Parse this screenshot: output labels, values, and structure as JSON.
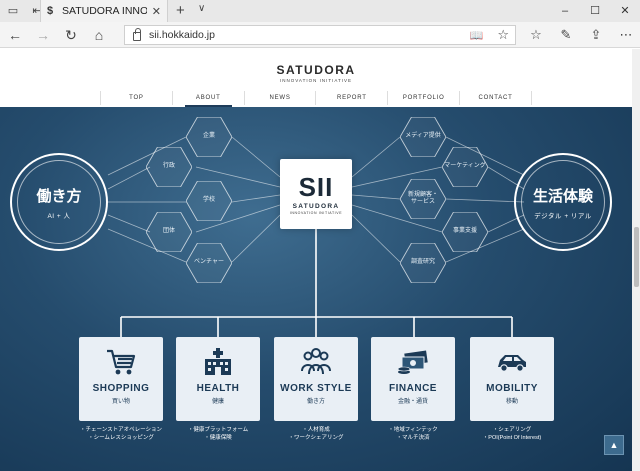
{
  "browser": {
    "tab_title": "SATUDORA INNOVATIO",
    "tab_icon": "dollar-s",
    "url": "sii.hokkaido.jp",
    "window_buttons": [
      "–",
      "☐",
      "✕"
    ]
  },
  "site": {
    "brand_name": "SATUDORA",
    "brand_sub": "INNOVATION INITIATIVE",
    "nav": [
      "TOP",
      "ABOUT",
      "NEWS",
      "REPORT",
      "PORTFOLIO",
      "CONTACT"
    ],
    "active_nav": "ABOUT"
  },
  "hero": {
    "left_circle": {
      "title": "働き方",
      "sub": "AI + 人"
    },
    "right_circle": {
      "title": "生活体験",
      "sub": "デジタル + リアル"
    },
    "left_hexes": [
      "企業",
      "行政",
      "学校",
      "団体",
      "ベンチャー"
    ],
    "right_hexes": [
      "メディア提供",
      "マーケティング",
      "新規顧客・\nサービス",
      "事業支援",
      "調査研究"
    ],
    "center_logo": {
      "mark": "SII",
      "name": "SATUDORA",
      "sub": "INNOVATION INITIATIVE"
    },
    "colors": {
      "bg_dark": "#153552",
      "bg_light": "#3f6d90",
      "card": "#e9eff5",
      "card_text": "#1c3a56"
    }
  },
  "cards": [
    {
      "title": "SHOPPING",
      "sub": "買い物",
      "icon": "cart-icon",
      "desc": [
        "・チェーンストアオペレーション",
        "・シームレスショッピング"
      ]
    },
    {
      "title": "HEALTH",
      "sub": "健康",
      "icon": "hospital-icon",
      "desc": [
        "・健康プラットフォーム",
        "・健康保険"
      ]
    },
    {
      "title": "WORK STYLE",
      "sub": "働き方",
      "icon": "people-icon",
      "desc": [
        "・人材育成",
        "・ワークシェアリング"
      ]
    },
    {
      "title": "FINANCE",
      "sub": "金融・通貨",
      "icon": "money-icon",
      "desc": [
        "・地域フィンテック",
        "・マルチ決済"
      ]
    },
    {
      "title": "MOBILITY",
      "sub": "移動",
      "icon": "car-icon",
      "desc": [
        "・シェアリング",
        "・POI(Point Of Interest)"
      ]
    }
  ]
}
